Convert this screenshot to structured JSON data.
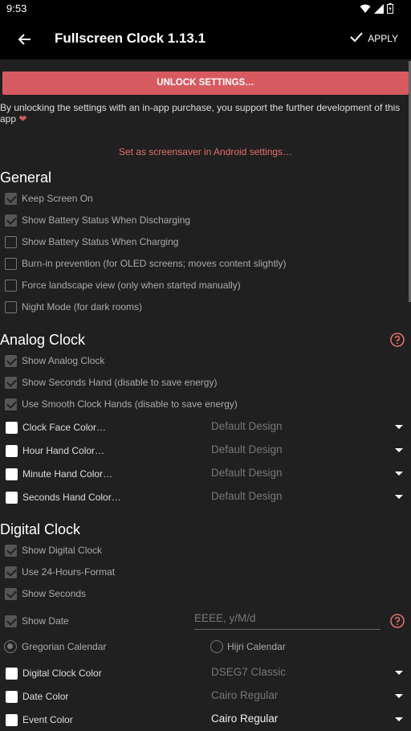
{
  "status": {
    "time": "9:53"
  },
  "appbar": {
    "title": "Fullscreen Clock 1.13.1",
    "apply_label": "APPLY"
  },
  "unlock_button": "UNLOCK SETTINGS…",
  "info_text": "By unlocking the settings with an in-app purchase, you support the further development of this app",
  "screensaver_link": "Set as screensaver in Android settings…",
  "general": {
    "title": "General",
    "keep_screen_on": "Keep Screen On",
    "battery_discharging": "Show Battery Status When Discharging",
    "battery_charging": "Show Battery Status When Charging",
    "burn_in": "Burn-in prevention (for OLED screens; moves content slightly)",
    "landscape": "Force landscape view (only when started manually)",
    "night_mode": "Night Mode (for dark rooms)"
  },
  "analog": {
    "title": "Analog Clock",
    "show_analog": "Show Analog Clock",
    "seconds_hand": "Show Seconds Hand (disable to save energy)",
    "smooth_hands": "Use Smooth Clock Hands (disable to save energy)",
    "face_color": "Clock Face Color…",
    "hour_color": "Hour Hand Color…",
    "minute_color": "Minute Hand Color…",
    "seconds_color": "Seconds Hand Color…",
    "default_design": "Default Design"
  },
  "digital": {
    "title": "Digital Clock",
    "show_digital": "Show Digital Clock",
    "use_24h": "Use 24-Hours-Format",
    "show_seconds": "Show Seconds",
    "show_date": "Show Date",
    "date_placeholder": "EEEE, y/M/d",
    "gregorian": "Gregorian Calendar",
    "hijri": "Hijri Calendar",
    "digital_color": "Digital Clock Color",
    "digital_font": "DSEG7 Classic",
    "date_color": "Date Color",
    "date_font": "Cairo Regular",
    "event_color": "Event Color",
    "event_font": "Cairo Regular"
  }
}
